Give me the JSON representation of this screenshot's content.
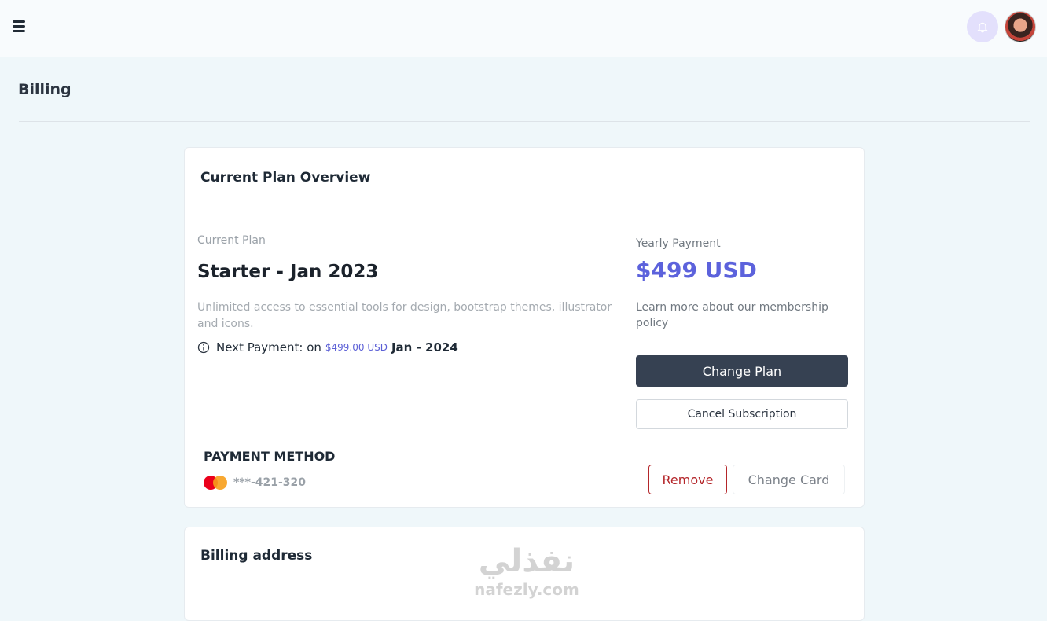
{
  "page": {
    "title": "Billing"
  },
  "plan_card": {
    "title": "Current Plan Overview",
    "current_plan_label": "Current Plan",
    "plan_name": "Starter - Jan 2023",
    "description": "Unlimited access to essential tools for design, bootstrap themes, illustrator and icons.",
    "next_payment_prefix": "Next Payment: on",
    "next_payment_amount": "$499.00 USD",
    "next_payment_date": "Jan - 2024",
    "yearly_label": "Yearly Payment",
    "price": "$499 USD",
    "learn_more": "Learn more about our membership policy",
    "change_plan_label": "Change Plan",
    "cancel_label": "Cancel Subscription"
  },
  "payment": {
    "title": "PAYMENT METHOD",
    "card_number": "***-421-320",
    "remove_label": "Remove",
    "change_card_label": "Change Card"
  },
  "address_card": {
    "title": "Billing address"
  },
  "watermark": {
    "arabic": "نفذلي",
    "latin": "nafezly.com"
  },
  "colors": {
    "accent": "#5c62dc",
    "primary_button": "#364152",
    "danger": "#b4262a"
  }
}
